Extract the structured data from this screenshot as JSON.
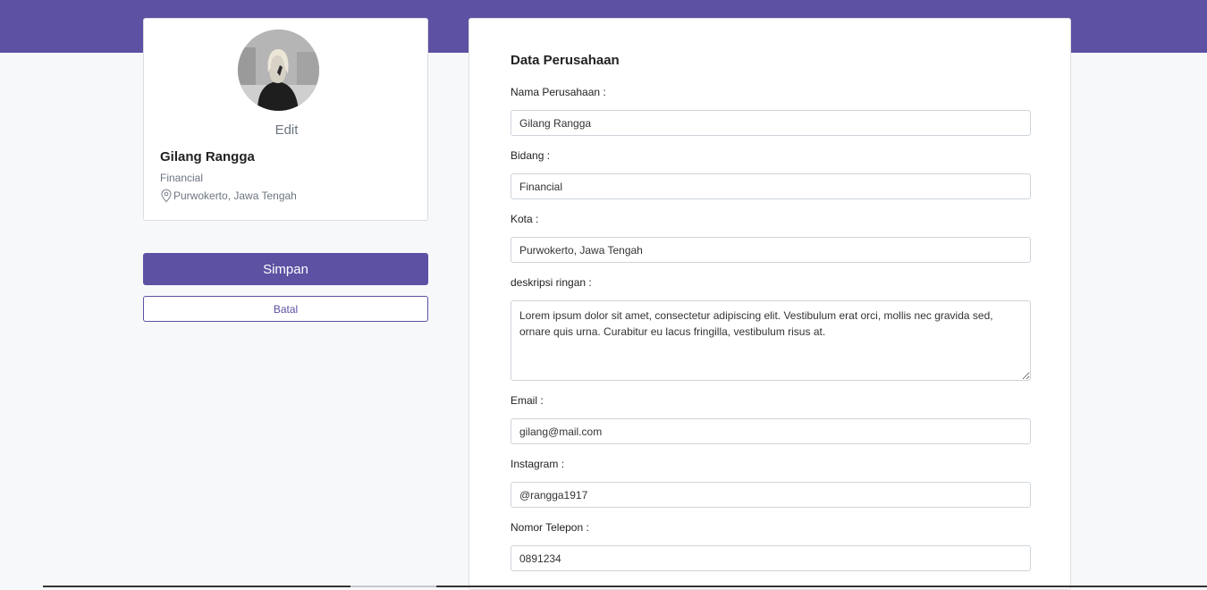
{
  "colors": {
    "brand": "#5c51a2",
    "page_background": "#f7f8fa",
    "muted_text": "#6c7580"
  },
  "profile": {
    "avatar_icon": "user-photo",
    "edit_label": "Edit",
    "name": "Gilang Rangga",
    "field": "Financial",
    "location_icon": "map-pin-icon",
    "location": "Purwokerto, Jawa Tengah"
  },
  "actions": {
    "save_label": "Simpan",
    "cancel_label": "Batal"
  },
  "form": {
    "title": "Data Perusahaan",
    "company_name": {
      "label": "Nama Perusahaan :",
      "value": "Gilang Rangga"
    },
    "sector": {
      "label": "Bidang :",
      "value": "Financial"
    },
    "city": {
      "label": "Kota :",
      "value": "Purwokerto, Jawa Tengah"
    },
    "description": {
      "label": "deskripsi ringan :",
      "value": "Lorem ipsum dolor sit amet, consectetur adipiscing elit. Vestibulum erat orci, mollis nec gravida sed, ornare quis urna. Curabitur eu lacus fringilla, vestibulum risus at."
    },
    "email": {
      "label": "Email :",
      "value": "gilang@mail.com"
    },
    "instagram": {
      "label": "Instagram :",
      "value": "@rangga1917"
    },
    "phone": {
      "label": "Nomor Telepon :",
      "value": "0891234"
    }
  }
}
